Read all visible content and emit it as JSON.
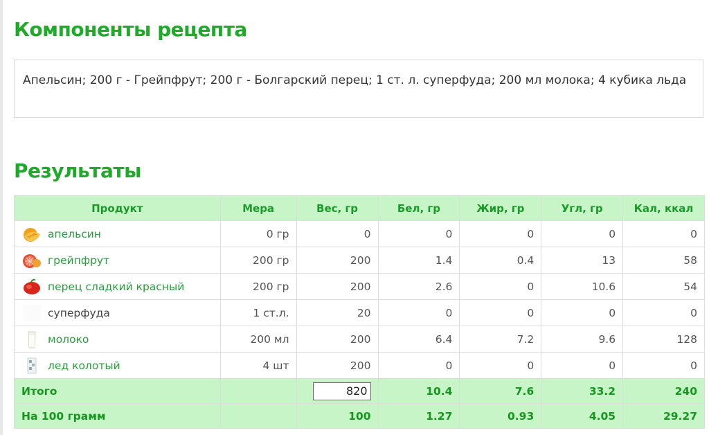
{
  "components": {
    "title": "Компоненты рецепта",
    "text": "Апельсин; 200 г - Грейпфрут; 200 г - Болгарский перец; 1 ст. л. суперфуда; 200 мл молока; 4 кубика льда"
  },
  "results": {
    "title": "Результаты",
    "headers": [
      "Продукт",
      "Мера",
      "Вес, гр",
      "Бел, гр",
      "Жир, гр",
      "Угл, гр",
      "Кал, ккал"
    ],
    "rows": [
      {
        "name": "апельсин",
        "icon": "orange-icon",
        "link": true,
        "measure": "0 гр",
        "weight": "0",
        "protein": "0",
        "fat": "0",
        "carbs": "0",
        "kcal": "0"
      },
      {
        "name": "грейпфрут",
        "icon": "grapefruit-icon",
        "link": true,
        "measure": "200 гр",
        "weight": "200",
        "protein": "1.4",
        "fat": "0.4",
        "carbs": "13",
        "kcal": "58"
      },
      {
        "name": "перец сладкий красный",
        "icon": "red-pepper-icon",
        "link": true,
        "measure": "200 гр",
        "weight": "200",
        "protein": "2.6",
        "fat": "0",
        "carbs": "10.6",
        "kcal": "54"
      },
      {
        "name": "суперфуда",
        "icon": "blank-icon",
        "link": false,
        "measure": "1 ст.л.",
        "weight": "20",
        "protein": "0",
        "fat": "0",
        "carbs": "0",
        "kcal": "0"
      },
      {
        "name": "молоко",
        "icon": "milk-glass-icon",
        "link": true,
        "measure": "200 мл",
        "weight": "200",
        "protein": "6.4",
        "fat": "7.2",
        "carbs": "9.6",
        "kcal": "128"
      },
      {
        "name": "лед колотый",
        "icon": "crushed-ice-icon",
        "link": true,
        "measure": "4 шт",
        "weight": "200",
        "protein": "0",
        "fat": "0",
        "carbs": "0",
        "kcal": "0"
      }
    ],
    "total": {
      "label": "Итого",
      "weight_input": "820",
      "protein": "10.4",
      "fat": "7.6",
      "carbs": "33.2",
      "kcal": "240"
    },
    "per100": {
      "label": "На 100 грамм",
      "weight": "100",
      "protein": "1.27",
      "fat": "0.93",
      "carbs": "4.05",
      "kcal": "29.27"
    }
  },
  "colors": {
    "accent_green": "#1faa2a",
    "header_bg": "#c8f5c8",
    "link_green": "#2a9d3c"
  }
}
